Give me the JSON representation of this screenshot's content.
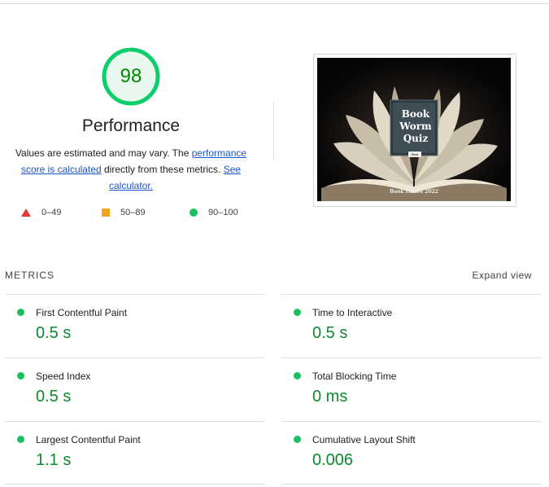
{
  "score": {
    "value": "98",
    "fraction": 0.98,
    "title": "Performance",
    "color": "#0cce6b"
  },
  "description": {
    "prefix": "Values are estimated and may vary. The ",
    "link1": "performance score is calculated",
    "middle": " directly from these metrics. ",
    "link2": "See calculator."
  },
  "legend": [
    {
      "icon": "triangle-icon",
      "range": "0–49",
      "color": "#e53935"
    },
    {
      "icon": "square-icon",
      "range": "50–89",
      "color": "#f4a31d"
    },
    {
      "icon": "circle-icon",
      "range": "90–100",
      "color": "#18c15e"
    }
  ],
  "screenshot": {
    "quiz_title_line1": "Book",
    "quiz_title_line2": "Worm",
    "quiz_title_line3": "Quiz",
    "button_label": "Start",
    "footer": "Book Eaters 2022"
  },
  "metrics": {
    "heading": "METRICS",
    "expand_label": "Expand view",
    "items": [
      {
        "label": "First Contentful Paint",
        "value": "0.5 s"
      },
      {
        "label": "Time to Interactive",
        "value": "0.5 s"
      },
      {
        "label": "Speed Index",
        "value": "0.5 s"
      },
      {
        "label": "Total Blocking Time",
        "value": "0 ms"
      },
      {
        "label": "Largest Contentful Paint",
        "value": "1.1 s"
      },
      {
        "label": "Cumulative Layout Shift",
        "value": "0.006"
      }
    ]
  }
}
